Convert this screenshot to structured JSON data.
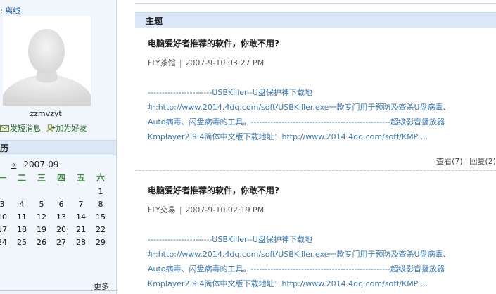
{
  "sidebar": {
    "status_prefix": ": ",
    "status_text": "离线",
    "username": "zzmvzyt",
    "send_message_label": "发短消息",
    "add_friend_label": "加为好友",
    "calendar_header": "历",
    "calendar": {
      "prev_label": "«",
      "month_label": "2007-09",
      "weekdays": [
        "一",
        "二",
        "三",
        "四",
        "五",
        "六"
      ],
      "weeks": [
        [
          "",
          "",
          "",
          "",
          "",
          "1"
        ],
        [
          "3",
          "4",
          "5",
          "6",
          "7",
          "8"
        ],
        [
          "10",
          "11",
          "12",
          "13",
          "14",
          "15"
        ],
        [
          "17",
          "18",
          "19",
          "20",
          "21",
          "22"
        ],
        [
          "24",
          "25",
          "26",
          "27",
          "28",
          "29"
        ]
      ]
    },
    "more_label": "更多"
  },
  "main": {
    "section_title": "主题",
    "posts": [
      {
        "title": "电脑爱好者推荐的软件，你敢不用?",
        "author": "FLY茶馆",
        "date": "2007-9-10 03:27 PM",
        "body_lines": [
          "-----------------------USBKiller--U盘保护神下载地",
          "址:http://www.2014.4dq.com/soft/USBKiller.exe一款专门用于预防及查杀U盘病毒、",
          "Auto病毒、闪盘病毒的工具。--------------------------------------------------超级影音播放器",
          "Kmplayer2.9.4简体中文版下载地址：http://www.2014.4dq.com/soft/KMP ..."
        ],
        "views": "查看(7)",
        "replies": "回复(2)"
      },
      {
        "title": "电脑爱好者推荐的软件，你敢不用?",
        "author": "FLY交易",
        "date": "2007-9-10 02:19 PM",
        "body_lines": [
          "-----------------------USBKiller--U盘保护神下载地",
          "址:http://www.2014.4dq.com/soft/USBKiller.exe一款专门用于预防及查杀U盘病毒、",
          "Auto病毒、闪盘病毒的工具。--------------------------------------------------超级影音播放器",
          "Kmplayer2.9.4简体中文版下载地址：http://www.2014.4dq.com/soft/KMP ..."
        ]
      }
    ]
  },
  "icons": {
    "avatar": "default-avatar-icon",
    "message": "message-icon",
    "add_friend": "add-friend-icon"
  },
  "colors": {
    "sidebar_bg": "#f1f6fd",
    "header_bg": "#dce8f7",
    "link_blue": "#3a77b5",
    "weekday_green": "#3c8a3c"
  }
}
